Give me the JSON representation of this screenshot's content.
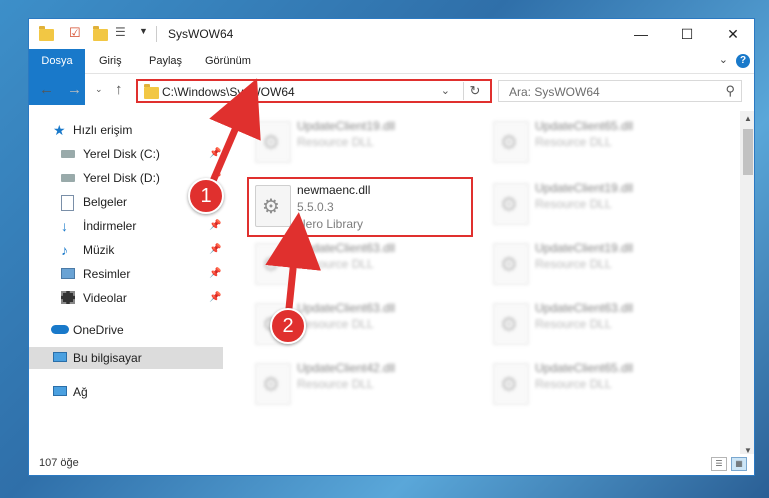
{
  "window": {
    "title": "SysWOW64",
    "controls": {
      "minimize": "—",
      "maximize": "☐",
      "close": "✕"
    }
  },
  "ribbon": {
    "tabs": [
      "Dosya",
      "Giriş",
      "Paylaş",
      "Görünüm"
    ],
    "help": "?"
  },
  "address": {
    "path": "C:\\Windows\\SysWOW64",
    "search_placeholder": "Ara: SysWOW64"
  },
  "nav": {
    "quick_access": "Hızlı erişim",
    "items": [
      {
        "label": "Yerel Disk (C:)",
        "icon": "drive-icon",
        "pinned": true
      },
      {
        "label": "Yerel Disk (D:)",
        "icon": "drive-icon",
        "pinned": true
      },
      {
        "label": "Belgeler",
        "icon": "documents-icon",
        "pinned": true
      },
      {
        "label": "İndirmeler",
        "icon": "downloads-icon",
        "pinned": true
      },
      {
        "label": "Müzik",
        "icon": "music-icon",
        "pinned": true
      },
      {
        "label": "Resimler",
        "icon": "pictures-icon",
        "pinned": true
      },
      {
        "label": "Videolar",
        "icon": "videos-icon",
        "pinned": true
      }
    ],
    "onedrive": "OneDrive",
    "this_pc": "Bu bilgisayar",
    "network": "Ağ"
  },
  "files": {
    "highlighted": {
      "name": "newmaenc.dll",
      "version": "5.5.0.3",
      "description": "Nero Library"
    },
    "background": [
      {
        "name": "UpdateClient19.dll",
        "type": "Resource DLL"
      },
      {
        "name": "UpdateClient65.dll",
        "type": "Resource DLL"
      },
      {
        "name": "UpdateClient19.dll",
        "type": "Resource DLL"
      },
      {
        "name": "UpdateClient63.dll",
        "type": "Resource DLL"
      },
      {
        "name": "UpdateClient19.dll",
        "type": "Resource DLL"
      },
      {
        "name": "UpdateClient63.dll",
        "type": "Resource DLL"
      },
      {
        "name": "UpdateClient63.dll",
        "type": "Resource DLL"
      },
      {
        "name": "UpdateClient42.dll",
        "type": "Resource DLL"
      },
      {
        "name": "UpdateClient65.dll",
        "type": "Resource DLL"
      }
    ]
  },
  "status": {
    "count": "107 öğe"
  },
  "annotations": {
    "step1": "1",
    "step2": "2"
  },
  "colors": {
    "accent": "#1979ca",
    "annotation": "#e0302e"
  }
}
